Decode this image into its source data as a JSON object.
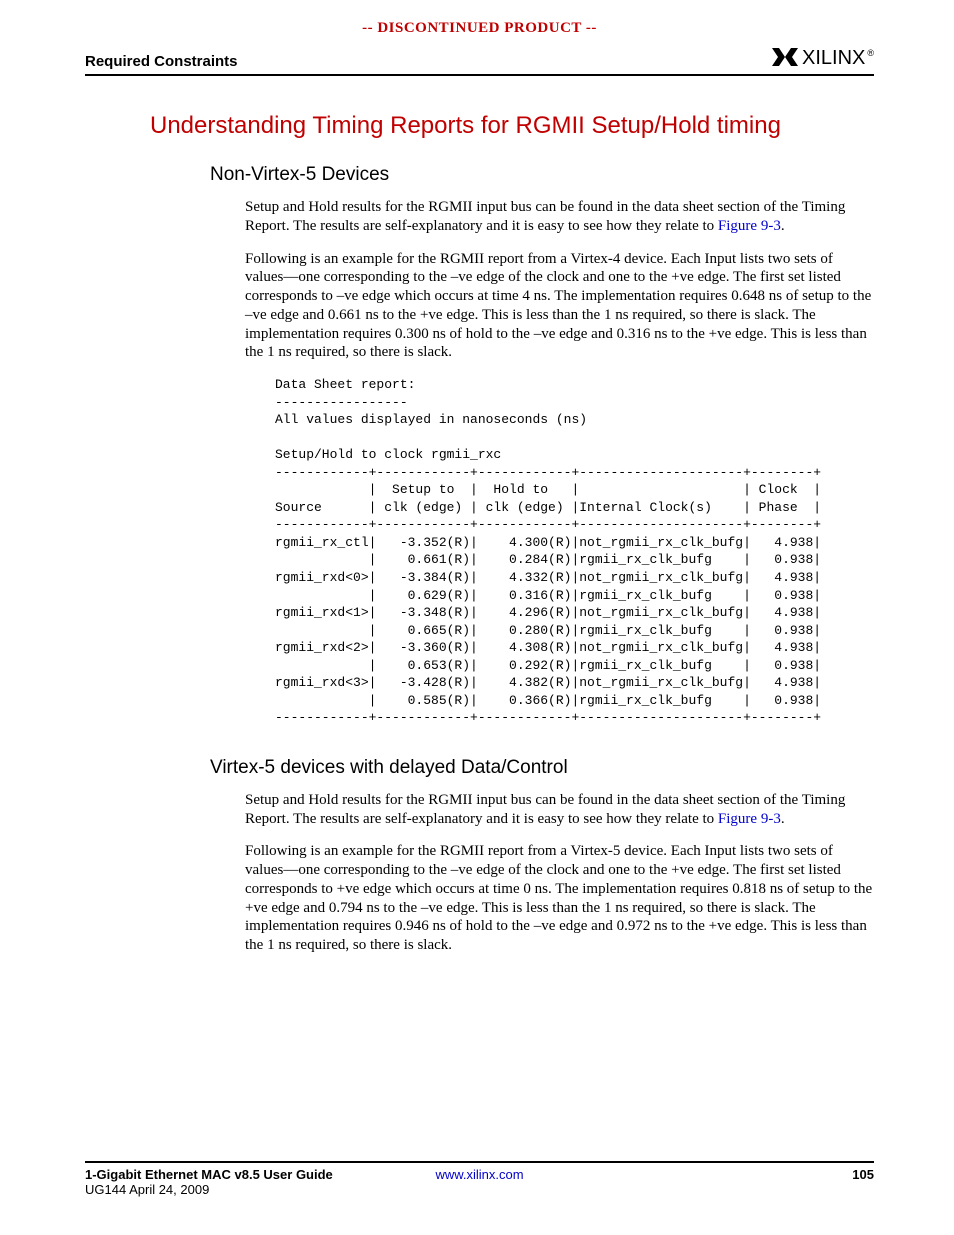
{
  "banner": "-- DISCONTINUED PRODUCT --",
  "header": {
    "section": "Required Constraints",
    "logo_text": "XILINX",
    "logo_reg": "®"
  },
  "h1": "Understanding Timing Reports for RGMII Setup/Hold timing",
  "sec1": {
    "heading": "Non-Virtex-5 Devices",
    "p1a": "Setup and Hold results for the RGMII input bus can be found in the data sheet section of the Timing Report. The results are self-explanatory and it is easy to see how they relate to ",
    "p1link": "Figure 9-3",
    "p1b": ".",
    "p2": "Following is an example for the RGMII report from a Virtex-4 device. Each Input lists two sets of values—one corresponding to the –ve edge of the clock and one to the +ve edge. The first set listed corresponds to –ve edge which occurs at time 4 ns. The implementation requires 0.648 ns of setup to the –ve edge and 0.661 ns to the +ve edge. This is less than the 1 ns required, so there is slack. The implementation requires 0.300 ns of hold to the –ve edge and 0.316 ns to the +ve edge. This is less than the 1 ns required, so there is slack.",
    "code": "Data Sheet report:\n-----------------\nAll values displayed in nanoseconds (ns)\n\nSetup/Hold to clock rgmii_rxc\n------------+------------+------------+---------------------+--------+\n            |  Setup to  |  Hold to   |                     | Clock  |\nSource      | clk (edge) | clk (edge) |Internal Clock(s)    | Phase  |\n------------+------------+------------+---------------------+--------+\nrgmii_rx_ctl|   -3.352(R)|    4.300(R)|not_rgmii_rx_clk_bufg|   4.938|\n            |    0.661(R)|    0.284(R)|rgmii_rx_clk_bufg    |   0.938|\nrgmii_rxd<0>|   -3.384(R)|    4.332(R)|not_rgmii_rx_clk_bufg|   4.938|\n            |    0.629(R)|    0.316(R)|rgmii_rx_clk_bufg    |   0.938|\nrgmii_rxd<1>|   -3.348(R)|    4.296(R)|not_rgmii_rx_clk_bufg|   4.938|\n            |    0.665(R)|    0.280(R)|rgmii_rx_clk_bufg    |   0.938|\nrgmii_rxd<2>|   -3.360(R)|    4.308(R)|not_rgmii_rx_clk_bufg|   4.938|\n            |    0.653(R)|    0.292(R)|rgmii_rx_clk_bufg    |   0.938|\nrgmii_rxd<3>|   -3.428(R)|    4.382(R)|not_rgmii_rx_clk_bufg|   4.938|\n            |    0.585(R)|    0.366(R)|rgmii_rx_clk_bufg    |   0.938|\n------------+------------+------------+---------------------+--------+"
  },
  "sec2": {
    "heading": "Virtex-5 devices with delayed Data/Control",
    "p1a": "Setup and Hold results for the RGMII input bus can be found in the data sheet section of the Timing Report. The results are self-explanatory and it is easy to see how they relate to ",
    "p1link": "Figure 9-3",
    "p1b": ".",
    "p2": "Following is an example for the RGMII report from a Virtex-5 device. Each Input lists two sets of values—one corresponding to the –ve edge of the clock and one to the +ve edge. The first set listed corresponds to +ve edge which occurs at time 0 ns. The implementation requires 0.818 ns of setup to the +ve edge and 0.794 ns to the –ve edge. This is less than the 1 ns required, so there is slack. The implementation requires 0.946 ns of hold to the –ve edge and 0.972 ns to the +ve edge. This is less than the 1 ns required, so there is slack."
  },
  "footer": {
    "title": "1-Gigabit Ethernet MAC v8.5 User Guide",
    "doc": "UG144 April 24, 2009",
    "url": "www.xilinx.com",
    "page": "105"
  }
}
